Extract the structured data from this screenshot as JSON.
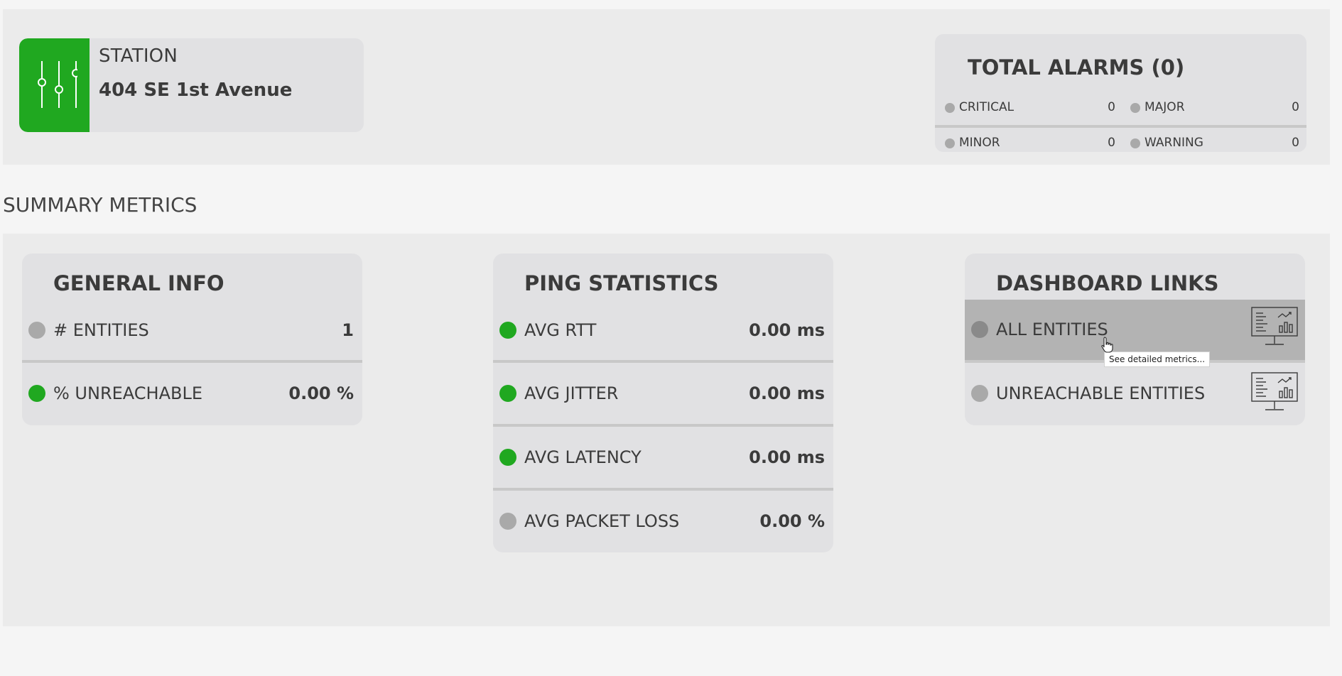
{
  "station": {
    "label": "STATION",
    "name": "404 SE 1st Avenue",
    "accent_color": "#20a820",
    "icon": "sliders-icon"
  },
  "alarms": {
    "title": "TOTAL ALARMS (0)",
    "items": [
      {
        "label": "CRITICAL",
        "value": "0"
      },
      {
        "label": "MAJOR",
        "value": "0"
      },
      {
        "label": "MINOR",
        "value": "0"
      },
      {
        "label": "WARNING",
        "value": "0"
      }
    ]
  },
  "summary": {
    "title": "SUMMARY METRICS"
  },
  "general_info": {
    "title": "GENERAL INFO",
    "rows": [
      {
        "label": "# ENTITIES",
        "value": "1",
        "status": "gray"
      },
      {
        "label": "% UNREACHABLE",
        "value": "0.00 %",
        "status": "green"
      }
    ]
  },
  "ping_statistics": {
    "title": "PING STATISTICS",
    "rows": [
      {
        "label": "AVG RTT",
        "value": "0.00 ms",
        "status": "green"
      },
      {
        "label": "AVG JITTER",
        "value": "0.00 ms",
        "status": "green"
      },
      {
        "label": "AVG LATENCY",
        "value": "0.00 ms",
        "status": "green"
      },
      {
        "label": "AVG PACKET LOSS",
        "value": "0.00 %",
        "status": "gray"
      }
    ]
  },
  "dashboard_links": {
    "title": "DASHBOARD LINKS",
    "rows": [
      {
        "label": "ALL ENTITIES",
        "icon": "dashboard-monitor-icon"
      },
      {
        "label": "UNREACHABLE ENTITIES",
        "icon": "dashboard-monitor-icon"
      }
    ],
    "tooltip": "See detailed metrics..."
  },
  "colors": {
    "status_green": "#20a820",
    "status_gray": "#a9a9a9",
    "panel_bg": "#e1e1e3",
    "band_bg": "#ebebeb"
  }
}
